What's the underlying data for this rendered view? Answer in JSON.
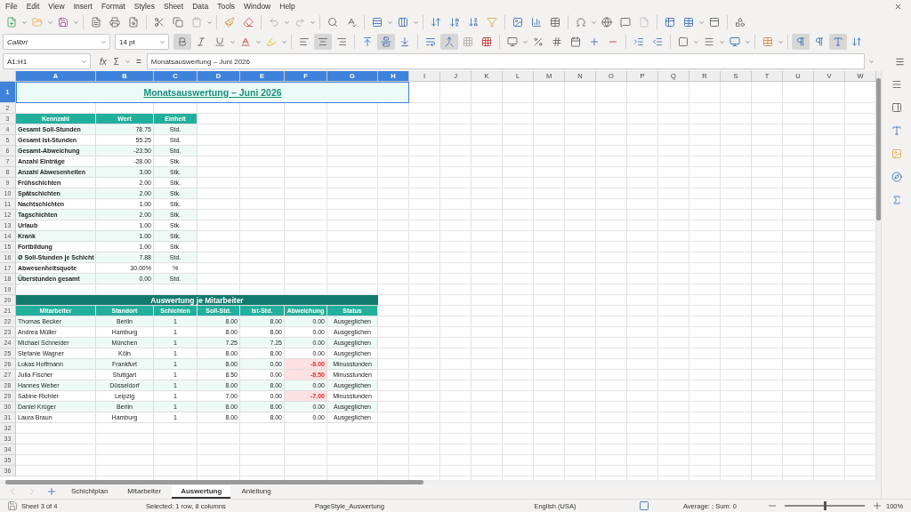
{
  "menu": [
    "File",
    "Edit",
    "View",
    "Insert",
    "Format",
    "Styles",
    "Sheet",
    "Data",
    "Tools",
    "Window",
    "Help"
  ],
  "font": {
    "name": "Calibri",
    "size": "14 pt",
    "bold": true,
    "align_center": true
  },
  "formula_bar": {
    "name_box": "A1:H1",
    "fx": "fx",
    "sum": "Σ",
    "equals": "=",
    "content": "Monatsauswertung – Juni 2026"
  },
  "columns": [
    {
      "label": "A",
      "selected": true
    },
    {
      "label": "B",
      "selected": true
    },
    {
      "label": "C",
      "selected": true
    },
    {
      "label": "D",
      "selected": true
    },
    {
      "label": "E",
      "selected": true
    },
    {
      "label": "F",
      "selected": true
    },
    {
      "label": "G",
      "selected": true
    },
    {
      "label": "H",
      "selected": true
    },
    {
      "label": "I",
      "selected": false
    },
    {
      "label": "J",
      "selected": false
    },
    {
      "label": "K",
      "selected": false
    },
    {
      "label": "L",
      "selected": false
    },
    {
      "label": "M",
      "selected": false
    },
    {
      "label": "N",
      "selected": false
    },
    {
      "label": "O",
      "selected": false
    },
    {
      "label": "P",
      "selected": false
    },
    {
      "label": "Q",
      "selected": false
    },
    {
      "label": "R",
      "selected": false
    },
    {
      "label": "S",
      "selected": false
    },
    {
      "label": "T",
      "selected": false
    },
    {
      "label": "U",
      "selected": false
    },
    {
      "label": "V",
      "selected": false
    },
    {
      "label": "W",
      "selected": false
    }
  ],
  "sheet_rows": [
    {
      "number": "1",
      "selected": true,
      "kind": "title",
      "text": "Monatsauswertung – Juni 2026"
    },
    {
      "number": "2",
      "selected": false,
      "kind": "empty"
    },
    {
      "number": "3",
      "selected": false,
      "kind": "kpi_header",
      "cells": [
        "Kennzahl",
        "Wert",
        "Einheit"
      ]
    },
    {
      "number": "4",
      "selected": false,
      "kind": "kpi",
      "cells": [
        "Gesamt Soll-Stunden",
        "78.75",
        "Std."
      ]
    },
    {
      "number": "5",
      "selected": false,
      "kind": "kpi",
      "cells": [
        "Gesamt Ist-Stunden",
        "55.25",
        "Std."
      ]
    },
    {
      "number": "6",
      "selected": false,
      "kind": "kpi",
      "cells": [
        "Gesamt-Abweichung",
        "-23.50",
        "Std."
      ]
    },
    {
      "number": "7",
      "selected": false,
      "kind": "kpi",
      "cells": [
        "Anzahl Einträge",
        "-28.00",
        "Stk."
      ]
    },
    {
      "number": "8",
      "selected": false,
      "kind": "kpi",
      "cells": [
        "Anzahl Abwesenheiten",
        "3.00",
        "Stk."
      ]
    },
    {
      "number": "9",
      "selected": false,
      "kind": "kpi",
      "cells": [
        "Frühschichten",
        "2.00",
        "Stk."
      ]
    },
    {
      "number": "10",
      "selected": false,
      "kind": "kpi",
      "cells": [
        "Spätschichten",
        "2.00",
        "Stk."
      ]
    },
    {
      "number": "11",
      "selected": false,
      "kind": "kpi",
      "cells": [
        "Nachtschichten",
        "1.00",
        "Stk."
      ]
    },
    {
      "number": "12",
      "selected": false,
      "kind": "kpi",
      "cells": [
        "Tagschichten",
        "2.00",
        "Stk."
      ]
    },
    {
      "number": "13",
      "selected": false,
      "kind": "kpi",
      "cells": [
        "Urlaub",
        "1.00",
        "Stk."
      ]
    },
    {
      "number": "14",
      "selected": false,
      "kind": "kpi",
      "cells": [
        "Krank",
        "1.00",
        "Stk."
      ]
    },
    {
      "number": "15",
      "selected": false,
      "kind": "kpi",
      "cells": [
        "Fortbildung",
        "1.00",
        "Stk."
      ]
    },
    {
      "number": "16",
      "selected": false,
      "kind": "kpi",
      "cells": [
        "Ø Soll-Stunden je Schicht",
        "7.88",
        "Std."
      ]
    },
    {
      "number": "17",
      "selected": false,
      "kind": "kpi",
      "cells": [
        "Abwesenheitsquote",
        "30.00%",
        "%"
      ]
    },
    {
      "number": "18",
      "selected": false,
      "kind": "kpi",
      "cells": [
        "Überstunden gesamt",
        "0.00",
        "Std."
      ]
    },
    {
      "number": "19",
      "selected": false,
      "kind": "empty"
    },
    {
      "number": "20",
      "selected": false,
      "kind": "section",
      "text": "Auswertung je Mitarbeiter"
    },
    {
      "number": "21",
      "selected": false,
      "kind": "staff_header",
      "cells": [
        "Mitarbeiter",
        "Standort",
        "Schichten",
        "Soll-Std.",
        "Ist-Std.",
        "Abweichung",
        "Status"
      ]
    },
    {
      "number": "22",
      "selected": false,
      "kind": "staff",
      "negative": false,
      "cells": [
        "Thomas Becker",
        "Berlin",
        "1",
        "8.00",
        "8.00",
        "0.00",
        "Ausgeglichen"
      ]
    },
    {
      "number": "23",
      "selected": false,
      "kind": "staff",
      "negative": false,
      "cells": [
        "Andrea Müller",
        "Hamburg",
        "1",
        "8.00",
        "8.00",
        "0.00",
        "Ausgeglichen"
      ]
    },
    {
      "number": "24",
      "selected": false,
      "kind": "staff",
      "negative": false,
      "cells": [
        "Michael Schneider",
        "München",
        "1",
        "7.25",
        "7.25",
        "0.00",
        "Ausgeglichen"
      ]
    },
    {
      "number": "25",
      "selected": false,
      "kind": "staff",
      "negative": false,
      "cells": [
        "Stefanie Wagner",
        "Köln",
        "1",
        "8.00",
        "8.00",
        "0.00",
        "Ausgeglichen"
      ]
    },
    {
      "number": "26",
      "selected": false,
      "kind": "staff",
      "negative": true,
      "cells": [
        "Lukas Hoffmann",
        "Frankfurt",
        "1",
        "8.00",
        "0.00",
        "-8.00",
        "Minusstunden"
      ]
    },
    {
      "number": "27",
      "selected": false,
      "kind": "staff",
      "negative": true,
      "cells": [
        "Julia Fischer",
        "Stuttgart",
        "1",
        "8.50",
        "0.00",
        "-8.50",
        "Minusstunden"
      ]
    },
    {
      "number": "28",
      "selected": false,
      "kind": "staff",
      "negative": false,
      "cells": [
        "Hannes Weber",
        "Düsseldorf",
        "1",
        "8.00",
        "8.00",
        "0.00",
        "Ausgeglichen"
      ]
    },
    {
      "number": "29",
      "selected": false,
      "kind": "staff",
      "negative": true,
      "cells": [
        "Sabine Richter",
        "Leipzig",
        "1",
        "7.00",
        "0.00",
        "-7.00",
        "Minusstunden"
      ]
    },
    {
      "number": "30",
      "selected": false,
      "kind": "staff",
      "negative": false,
      "cells": [
        "Daniel Krüger",
        "Berlin",
        "1",
        "8.00",
        "8.00",
        "0.00",
        "Ausgeglichen"
      ]
    },
    {
      "number": "31",
      "selected": false,
      "kind": "staff",
      "negative": false,
      "cells": [
        "Laura Braun",
        "Hamburg",
        "1",
        "8.00",
        "8.00",
        "0.00",
        "Ausgeglichen"
      ]
    },
    {
      "number": "32",
      "selected": false,
      "kind": "empty"
    },
    {
      "number": "33",
      "selected": false,
      "kind": "empty"
    },
    {
      "number": "34",
      "selected": false,
      "kind": "empty"
    },
    {
      "number": "35",
      "selected": false,
      "kind": "empty"
    },
    {
      "number": "36",
      "selected": false,
      "kind": "empty"
    }
  ],
  "sheet_tabs": [
    {
      "label": "Schichtplan",
      "selected": false
    },
    {
      "label": "Mitarbeiter",
      "selected": false
    },
    {
      "label": "Auswertung",
      "selected": true
    },
    {
      "label": "Anleitung",
      "selected": false
    }
  ],
  "status_bar": {
    "sheet": "Sheet 3 of 4",
    "selection": "Selected: 1 row, 8 columns",
    "page_style": "PageStyle_Auswertung",
    "language": "English (USA)",
    "summary": "Average: ; Sum: 0",
    "zoom": "100%",
    "zoom_slider": {
      "level": 0.5
    }
  }
}
